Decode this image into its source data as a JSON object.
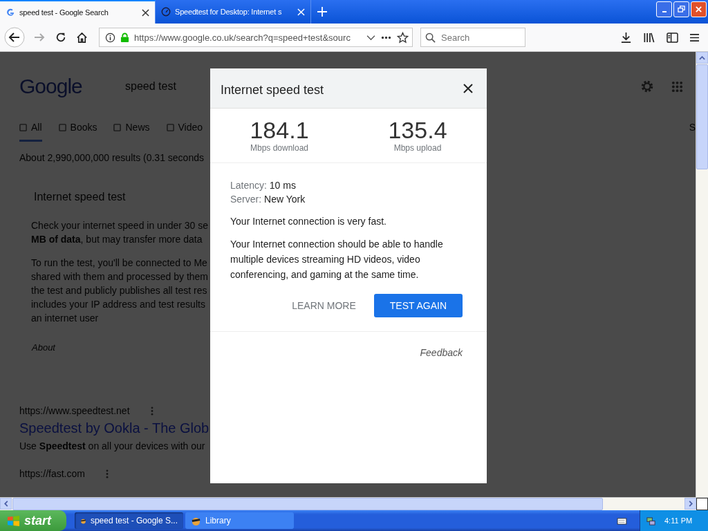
{
  "browser": {
    "tabs": [
      {
        "title": "speed test - Google Search",
        "selected": true
      },
      {
        "title": "Speedtest for Desktop: Internet s",
        "selected": false
      }
    ],
    "url": "https://www.google.co.uk/search?q=speed+test&sourc",
    "search_placeholder": "Search"
  },
  "page": {
    "logo": "Google",
    "query": "speed test",
    "nav": [
      {
        "label": "All",
        "selected": true
      },
      {
        "label": "Books",
        "selected": false
      },
      {
        "label": "News",
        "selected": false
      },
      {
        "label": "Video",
        "selected": false
      }
    ],
    "nav_cut": "S",
    "result_stats": "About 2,990,000,000 results (0.31 seconds",
    "widget_title": "Internet speed test",
    "paragraphs": [
      [
        "Check your internet speed in under 30 se",
        "**MB of data**, but may transfer more data"
      ],
      [
        "To run the test, you'll be connected to Me",
        "shared with them and processed by them",
        "the test and publicly publishes all test res",
        "includes your IP address and test results",
        "an internet user"
      ]
    ],
    "about": "About",
    "results": [
      {
        "url": "https://www.speedtest.net",
        "title": "Speedtest by Ookla - The Glob",
        "snippet": "Use **Speedtest** on all your devices with our"
      },
      {
        "url": "https://fast.com"
      }
    ]
  },
  "dialog": {
    "title": "Internet speed test",
    "metrics": [
      {
        "value": "184.1",
        "label": "Mbps download"
      },
      {
        "value": "135.4",
        "label": "Mbps upload"
      }
    ],
    "details": [
      {
        "label": "Latency:",
        "value": "10 ms"
      },
      {
        "label": "Server:",
        "value": "New York"
      }
    ],
    "verdict": "Your Internet connection is very fast.",
    "description": "Your Internet connection should be able to handle multiple devices streaming HD videos, video conferencing, and gaming at the same time.",
    "buttons": [
      {
        "label": "LEARN MORE",
        "kind": "text"
      },
      {
        "label": "TEST AGAIN",
        "kind": "primary"
      }
    ],
    "feedback": "Feedback"
  },
  "taskbar": {
    "start": "start",
    "tasks": [
      {
        "label": "speed test - Google S...",
        "selected": true
      },
      {
        "label": "Library",
        "selected": false
      }
    ],
    "clock": "4:11 PM"
  }
}
